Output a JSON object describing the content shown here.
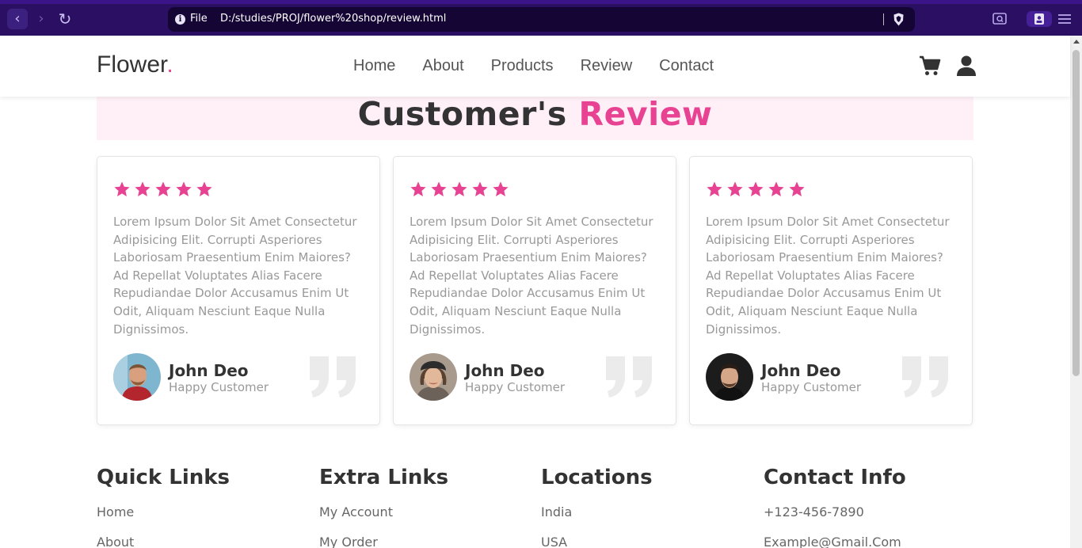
{
  "browser": {
    "file_label": "File",
    "url": "D:/studies/PROJ/flower%20shop/review.html",
    "icons": [
      "back-icon",
      "forward-icon",
      "reload-icon",
      "info-icon",
      "brave-shield-icon",
      "search-panel-icon",
      "wallet-icon",
      "menu-icon"
    ]
  },
  "header": {
    "logo_text": "Flower",
    "logo_dot": ".",
    "nav": [
      "Home",
      "About",
      "Products",
      "Review",
      "Contact"
    ],
    "icons": [
      "cart-icon",
      "user-icon"
    ]
  },
  "section": {
    "title_main": "Customer's",
    "title_accent": "Review"
  },
  "reviews": [
    {
      "stars": 5,
      "text": "Lorem Ipsum Dolor Sit Amet Consectetur Adipisicing Elit. Corrupti Asperiores Laboriosam Praesentium Enim Maiores? Ad Repellat Voluptates Alias Facere Repudiandae Dolor Accusamus Enim Ut Odit, Aliquam Nesciunt Eaque Nulla Dignissimos.",
      "name": "John Deo",
      "role": "Happy Customer"
    },
    {
      "stars": 5,
      "text": "Lorem Ipsum Dolor Sit Amet Consectetur Adipisicing Elit. Corrupti Asperiores Laboriosam Praesentium Enim Maiores? Ad Repellat Voluptates Alias Facere Repudiandae Dolor Accusamus Enim Ut Odit, Aliquam Nesciunt Eaque Nulla Dignissimos.",
      "name": "John Deo",
      "role": "Happy Customer"
    },
    {
      "stars": 5,
      "text": "Lorem Ipsum Dolor Sit Amet Consectetur Adipisicing Elit. Corrupti Asperiores Laboriosam Praesentium Enim Maiores? Ad Repellat Voluptates Alias Facere Repudiandae Dolor Accusamus Enim Ut Odit, Aliquam Nesciunt Eaque Nulla Dignissimos.",
      "name": "John Deo",
      "role": "Happy Customer"
    }
  ],
  "footer": [
    {
      "title": "Quick Links",
      "links": [
        "Home",
        "About"
      ]
    },
    {
      "title": "Extra Links",
      "links": [
        "My Account",
        "My Order"
      ]
    },
    {
      "title": "Locations",
      "links": [
        "India",
        "USA"
      ]
    },
    {
      "title": "Contact Info",
      "links": [
        "+123-456-7890",
        "Example@Gmail.Com"
      ]
    }
  ],
  "colors": {
    "accent": "#e84393",
    "browser_chrome": "#2a0f63",
    "heading_bg": "#fff0f7"
  }
}
